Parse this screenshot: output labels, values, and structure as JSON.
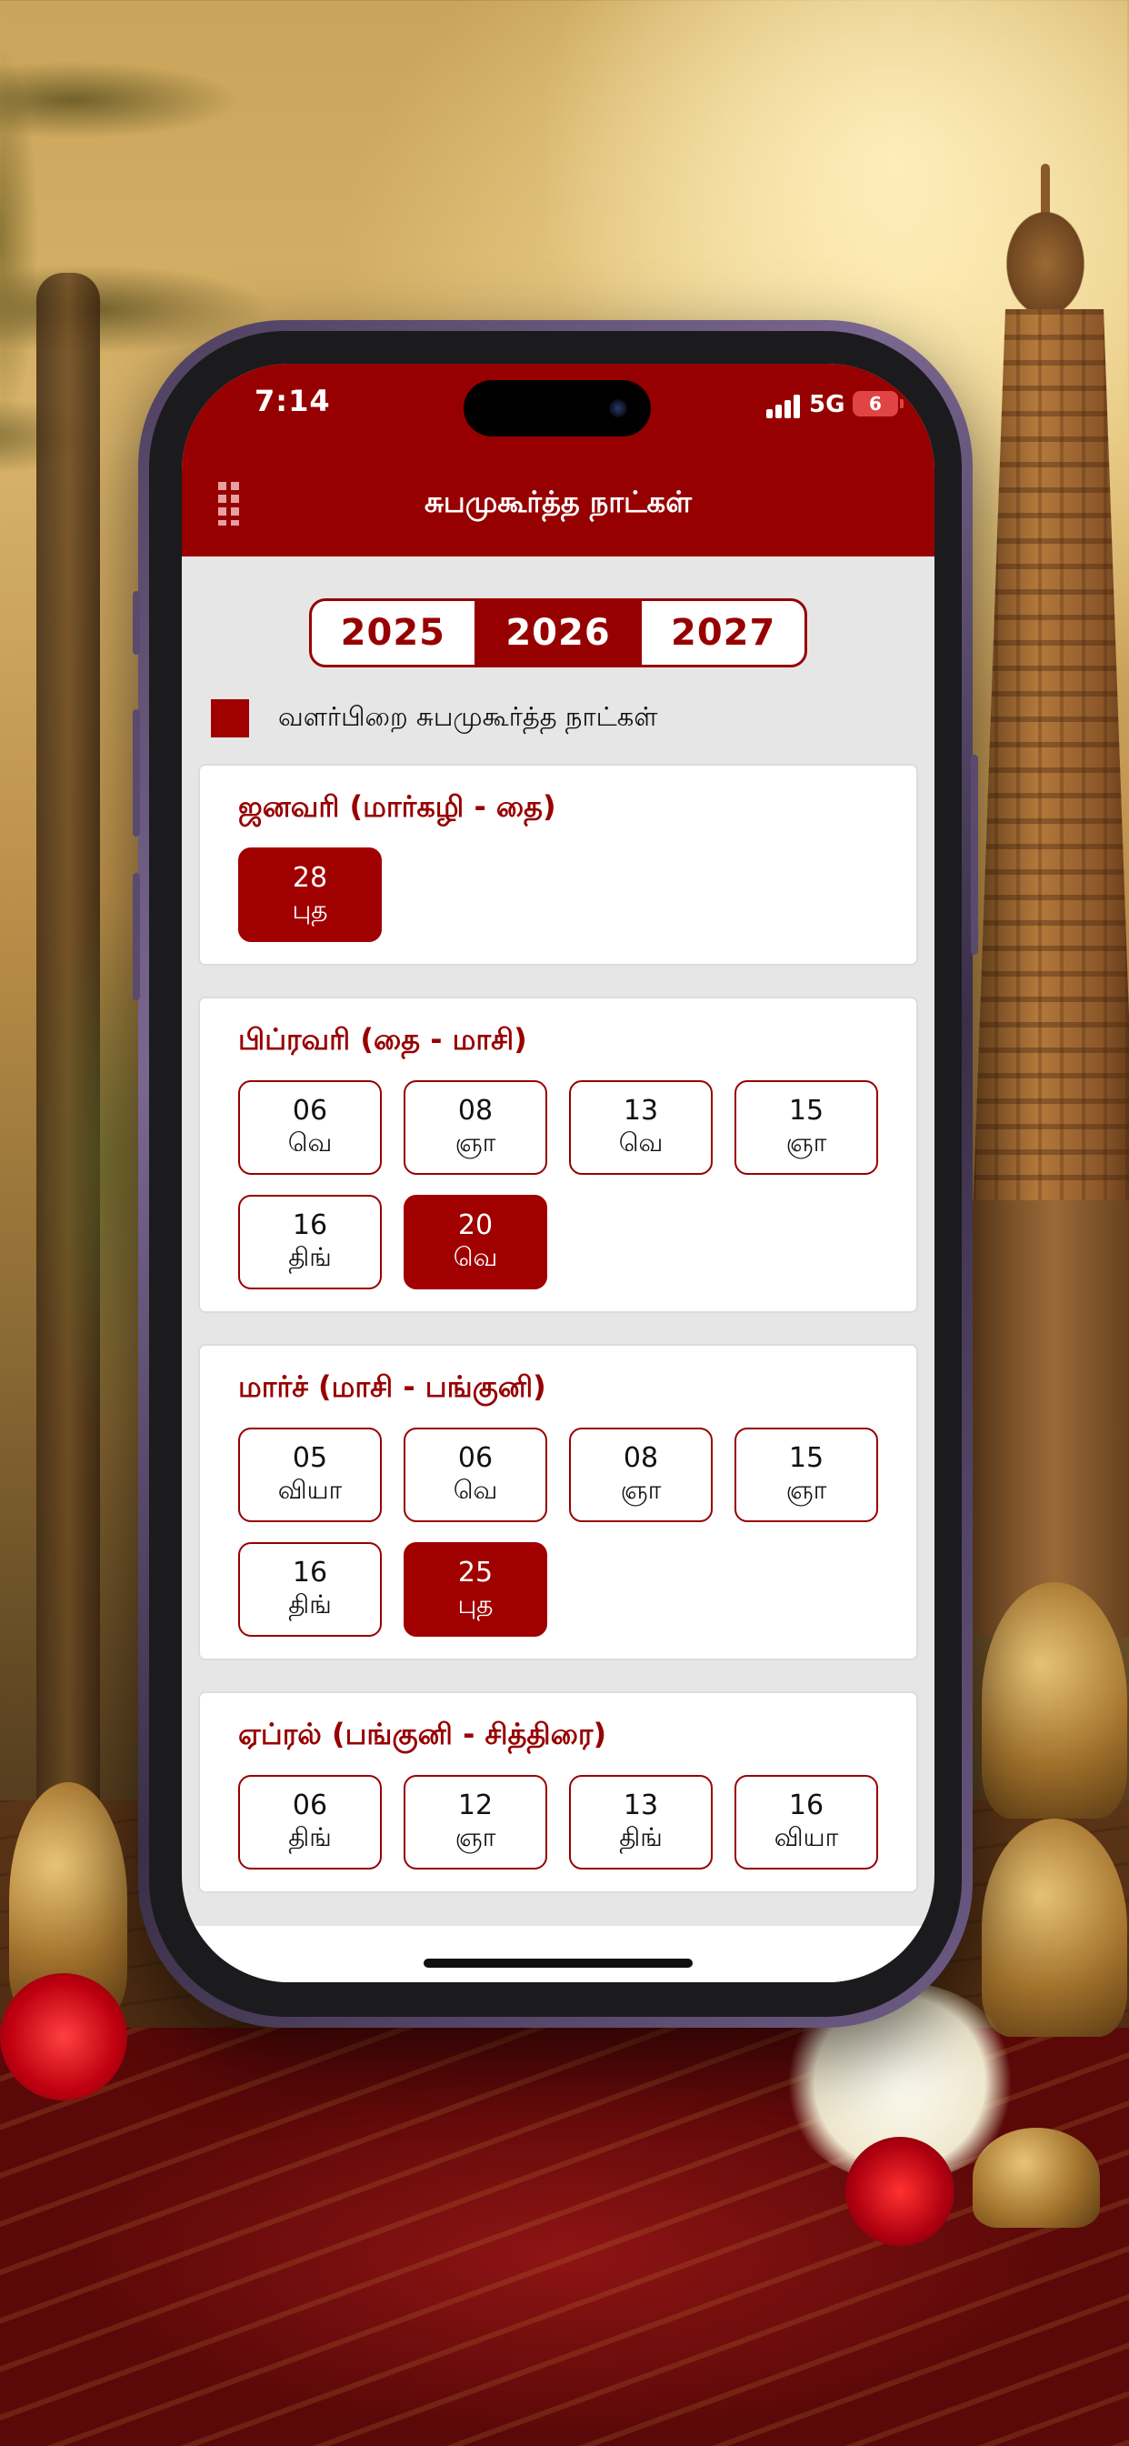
{
  "status_bar": {
    "time": "7:14",
    "network": "5G",
    "battery": "6"
  },
  "header": {
    "title": "சுபமுகூர்த்த நாட்கள்"
  },
  "years": [
    "2025",
    "2026",
    "2027"
  ],
  "selected_year": "2026",
  "legend": {
    "label": "வளர்பிறை சுபமுகூர்த்த நாட்கள்",
    "color": "#a00000"
  },
  "colors": {
    "primary": "#970000",
    "highlight": "#a00000"
  },
  "months": [
    {
      "title": "ஜனவரி (மார்கழி - தை)",
      "dates": [
        {
          "num": "28",
          "day": "புத",
          "highlight": true
        }
      ]
    },
    {
      "title": "பிப்ரவரி (தை - மாசி)",
      "dates": [
        {
          "num": "06",
          "day": "வெ",
          "highlight": false
        },
        {
          "num": "08",
          "day": "ஞா",
          "highlight": false
        },
        {
          "num": "13",
          "day": "வெ",
          "highlight": false
        },
        {
          "num": "15",
          "day": "ஞா",
          "highlight": false
        },
        {
          "num": "16",
          "day": "திங்",
          "highlight": false
        },
        {
          "num": "20",
          "day": "வெ",
          "highlight": true
        }
      ]
    },
    {
      "title": "மார்ச் (மாசி - பங்குனி)",
      "dates": [
        {
          "num": "05",
          "day": "வியா",
          "highlight": false
        },
        {
          "num": "06",
          "day": "வெ",
          "highlight": false
        },
        {
          "num": "08",
          "day": "ஞா",
          "highlight": false
        },
        {
          "num": "15",
          "day": "ஞா",
          "highlight": false
        },
        {
          "num": "16",
          "day": "திங்",
          "highlight": false
        },
        {
          "num": "25",
          "day": "புத",
          "highlight": true
        }
      ]
    },
    {
      "title": "ஏப்ரல் (பங்குனி - சித்திரை)",
      "dates": [
        {
          "num": "06",
          "day": "திங்",
          "highlight": false
        },
        {
          "num": "12",
          "day": "ஞா",
          "highlight": false
        },
        {
          "num": "13",
          "day": "திங்",
          "highlight": false
        },
        {
          "num": "16",
          "day": "வியா",
          "highlight": false
        }
      ]
    }
  ]
}
